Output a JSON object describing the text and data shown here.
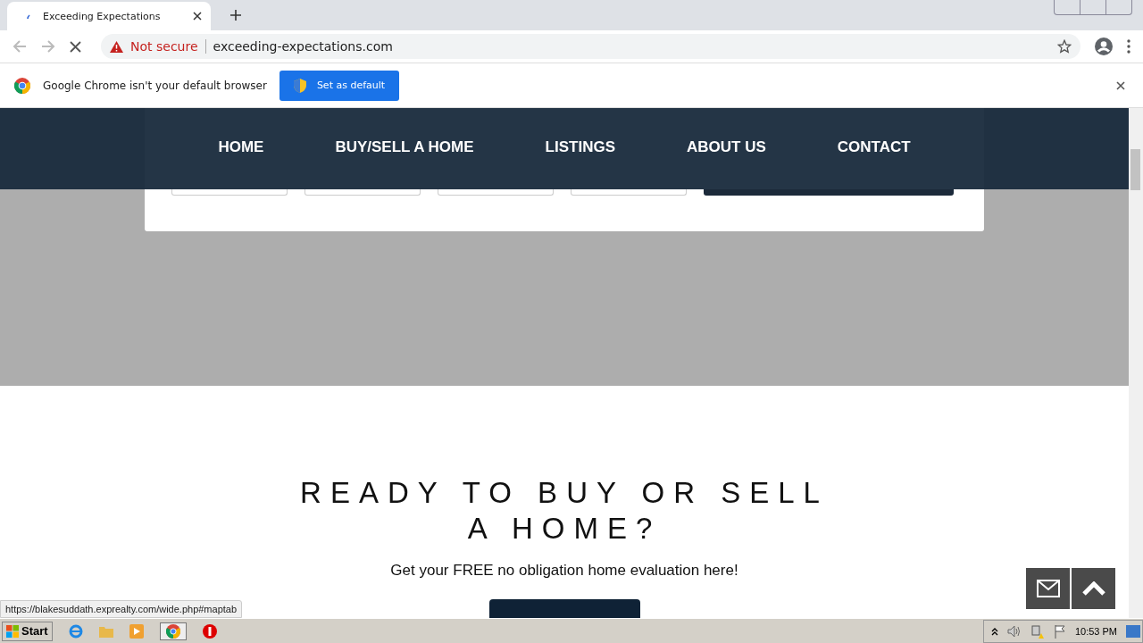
{
  "tab": {
    "title": "Exceeding Expectations"
  },
  "address_bar": {
    "security": "Not secure",
    "url": "exceeding-expectations.com"
  },
  "infobar": {
    "message": "Google Chrome isn't your default browser",
    "button": "Set as default"
  },
  "nav": [
    {
      "label": "HOME"
    },
    {
      "label": "BUY/SELL A HOME"
    },
    {
      "label": "LISTINGS"
    },
    {
      "label": "ABOUT US"
    },
    {
      "label": "CONTACT"
    }
  ],
  "cta": {
    "heading": "READY TO BUY OR SELL A HOME?",
    "text": "Get your FREE no obligation home evaluation here!"
  },
  "status_url": "https://blakesuddath.exprealty.com/wide.php#maptab",
  "taskbar": {
    "start": "Start",
    "clock": "10:53 PM"
  }
}
